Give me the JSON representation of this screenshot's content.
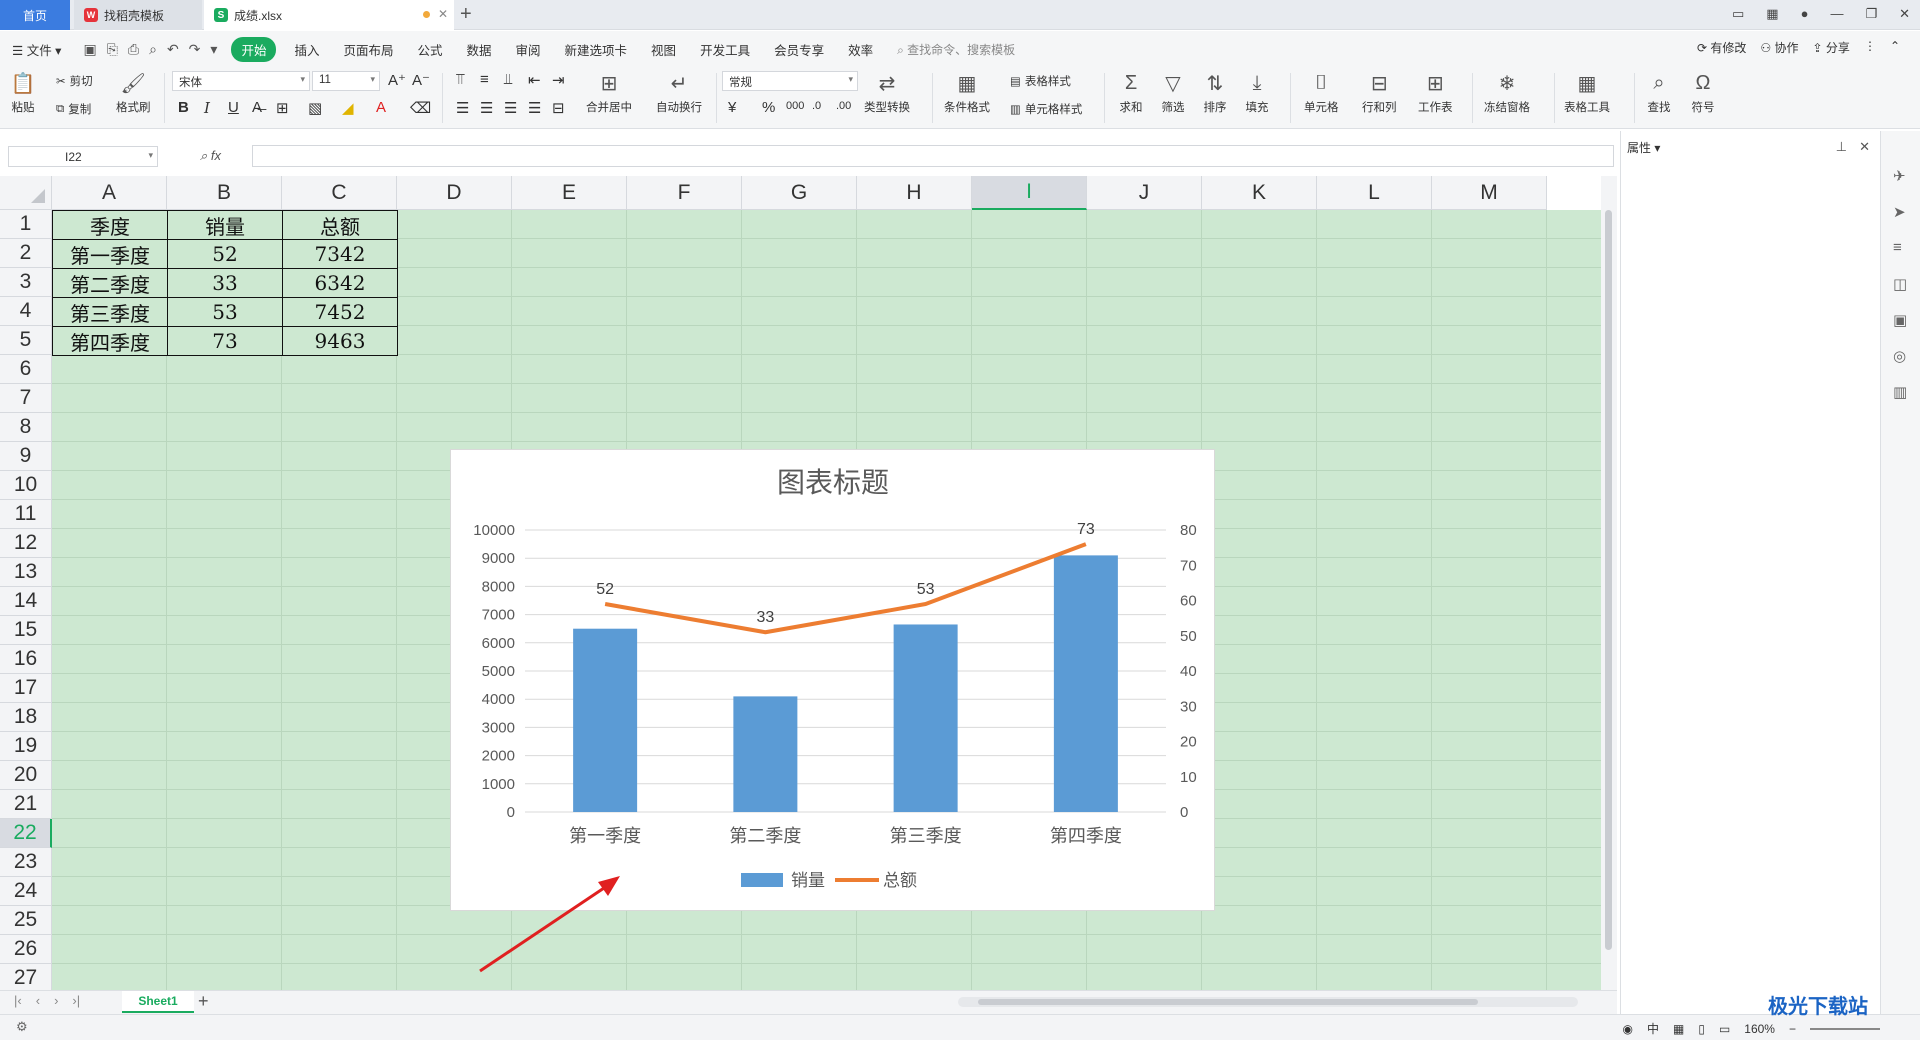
{
  "tabs": [
    {
      "label": "首页"
    },
    {
      "label": "找稻壳模板"
    },
    {
      "label": "成绩.xlsx"
    }
  ],
  "menu": {
    "file": "文件",
    "items": [
      "开始",
      "插入",
      "页面布局",
      "公式",
      "数据",
      "审阅",
      "新建选项卡",
      "视图",
      "开发工具",
      "会员专享",
      "效率"
    ],
    "search": "查找命令、搜索模板",
    "right": [
      "有修改",
      "协作",
      "分享"
    ]
  },
  "ribbon": {
    "paste": "粘贴",
    "cut": "剪切",
    "copy": "复制",
    "format_painter": "格式刷",
    "font_name": "宋体",
    "font_size": "11",
    "bold": "B",
    "italic": "I",
    "underline": "U",
    "merge_center": "合并居中",
    "wrap": "自动换行",
    "number_format": "常规",
    "currency": "¥",
    "percent": "%",
    "type_convert": "类型转换",
    "cond_format": "条件格式",
    "table_style": "表格样式",
    "cell_style": "单元格样式",
    "sum": "求和",
    "filter": "筛选",
    "sort": "排序",
    "fill": "填充",
    "cell": "单元格",
    "row_col": "行和列",
    "worksheet": "工作表",
    "freeze": "冻结窗格",
    "table_tools": "表格工具",
    "find": "查找",
    "symbol": "符号"
  },
  "formula_bar": {
    "name_box": "I22",
    "fx": "fx",
    "value": ""
  },
  "columns": [
    "A",
    "B",
    "C",
    "D",
    "E",
    "F",
    "G",
    "H",
    "I",
    "J",
    "K",
    "L",
    "M"
  ],
  "selected_column": "I",
  "rows": [
    "1",
    "2",
    "3",
    "4",
    "5",
    "6",
    "7",
    "8",
    "9",
    "10",
    "11",
    "12",
    "13",
    "14",
    "15",
    "16",
    "17",
    "18",
    "19",
    "20",
    "21",
    "22",
    "23",
    "24",
    "25",
    "26",
    "27"
  ],
  "selected_row": "22",
  "table": {
    "header": [
      "季度",
      "销量",
      "总额"
    ],
    "rows": [
      [
        "第一季度",
        "52",
        "7342"
      ],
      [
        "第二季度",
        "33",
        "6342"
      ],
      [
        "第三季度",
        "53",
        "7452"
      ],
      [
        "第四季度",
        "73",
        "9463"
      ]
    ]
  },
  "chart_data": {
    "type": "bar",
    "title": "图表标题",
    "categories": [
      "第一季度",
      "第二季度",
      "第三季度",
      "第四季度"
    ],
    "y_left_ticks": [
      "0",
      "1000",
      "2000",
      "3000",
      "4000",
      "5000",
      "6000",
      "7000",
      "8000",
      "9000",
      "10000"
    ],
    "y_right_ticks": [
      "0",
      "10",
      "20",
      "30",
      "40",
      "50",
      "60",
      "70",
      "80"
    ],
    "ylim_left": [
      0,
      10000
    ],
    "ylim_right": [
      0,
      80
    ],
    "series": [
      {
        "name": "销量",
        "type": "bar",
        "axis": "left",
        "values": [
          6500,
          4100,
          6650,
          9100
        ],
        "labels": [
          "52",
          "33",
          "53",
          "73"
        ],
        "color": "#5b9bd5"
      },
      {
        "name": "总额",
        "type": "line",
        "axis": "right",
        "values": [
          59,
          51,
          59,
          76
        ],
        "color": "#ed7d31"
      }
    ],
    "grid": true,
    "legend": "bottom"
  },
  "sheet_tabs": [
    "Sheet1"
  ],
  "status": {
    "zoom": "160%",
    "ime": "中"
  },
  "panel": {
    "title": "属性"
  },
  "watermark": "极光下载站",
  "colors": {
    "accent": "#1aab5f",
    "grid_bg": "#cde8d1",
    "home_tab": "#3b7ce0",
    "arrow": "#e02020"
  }
}
